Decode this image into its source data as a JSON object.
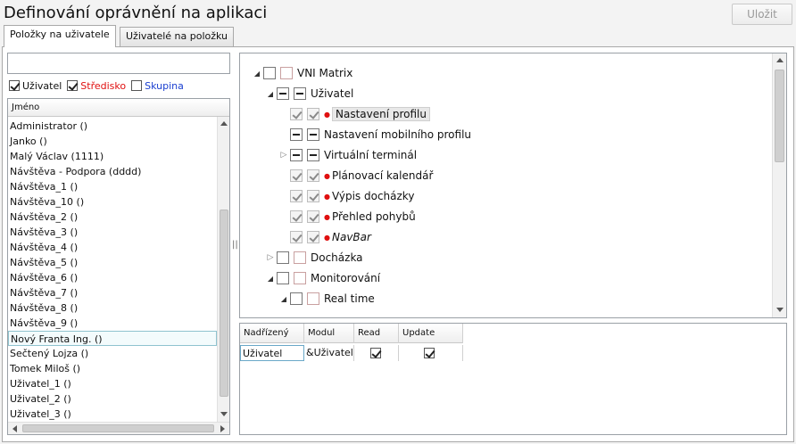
{
  "page": {
    "title": "Definování oprávnění na aplikaci",
    "save_label": "Uložit"
  },
  "tabs": [
    {
      "label": "Položky na uživatele",
      "active": true
    },
    {
      "label": "Uživatelé na položku",
      "active": false
    }
  ],
  "filter": {
    "search_value": "",
    "options": [
      {
        "label": "Uživatel",
        "checked": true,
        "color": "#111111"
      },
      {
        "label": "Středisko",
        "checked": true,
        "color": "#e01010"
      },
      {
        "label": "Skupina",
        "checked": false,
        "color": "#1a3fd0"
      }
    ]
  },
  "users_grid": {
    "header": "Jméno",
    "rows": [
      "Administrator ()",
      "Janko ()",
      "Malý Václav (1111)",
      "Návštěva - Podpora (dddd)",
      "Návštěva_1 ()",
      "Návštěva_10 ()",
      "Návštěva_2 ()",
      "Návštěva_3 ()",
      "Návštěva_4 ()",
      "Návštěva_5 ()",
      "Návštěva_6 ()",
      "Návštěva_7 ()",
      "Návštěva_8 ()",
      "Návštěva_9 ()",
      "Nový Franta Ing. ()",
      "Sečtený Lojza ()",
      "Tomek Miloš ()",
      "Uživatel_1 ()",
      "Uživatel_2 ()",
      "Uživatel_3 ()"
    ],
    "selected_index": 14
  },
  "tree": {
    "nodes": [
      {
        "label": "VNI Matrix",
        "expander": "expanded",
        "box1": "empty",
        "box2": "empty"
      },
      {
        "label": "Uživatel",
        "expander": "expanded",
        "box1": "partial",
        "box2": "partial"
      },
      {
        "label": "Nastavení profilu",
        "expander": "none",
        "box1": "checked",
        "box2": "checked",
        "dot": true,
        "highlight": true
      },
      {
        "label": "Nastavení mobilního profilu",
        "expander": "none",
        "box1": "partial",
        "box2": "partial"
      },
      {
        "label": "Virtuální terminál",
        "expander": "collapsed",
        "box1": "partial",
        "box2": "partial"
      },
      {
        "label": "Plánovací kalendář",
        "expander": "none",
        "box1": "checked",
        "box2": "checked",
        "dot": true
      },
      {
        "label": "Výpis docházky",
        "expander": "none",
        "box1": "checked",
        "box2": "checked",
        "dot": true
      },
      {
        "label": "Přehled pohybů",
        "expander": "none",
        "box1": "checked",
        "box2": "checked",
        "dot": true
      },
      {
        "label": "NavBar",
        "expander": "none",
        "box1": "checked",
        "box2": "checked",
        "dot": true,
        "italic": true
      },
      {
        "label": "Docházka",
        "expander": "collapsed",
        "box1": "empty",
        "box2": "empty"
      },
      {
        "label": "Monitorování",
        "expander": "expanded",
        "box1": "empty",
        "box2": "empty"
      },
      {
        "label": "Real time",
        "expander": "expanded",
        "box1": "empty",
        "box2": "empty"
      }
    ]
  },
  "permissions": {
    "columns": [
      "Nadřízený",
      "Modul",
      "Read",
      "Update"
    ],
    "rows": [
      {
        "nadrizeny": "Uživatel",
        "modul": "&Uživatel",
        "read": true,
        "update": true
      }
    ]
  }
}
